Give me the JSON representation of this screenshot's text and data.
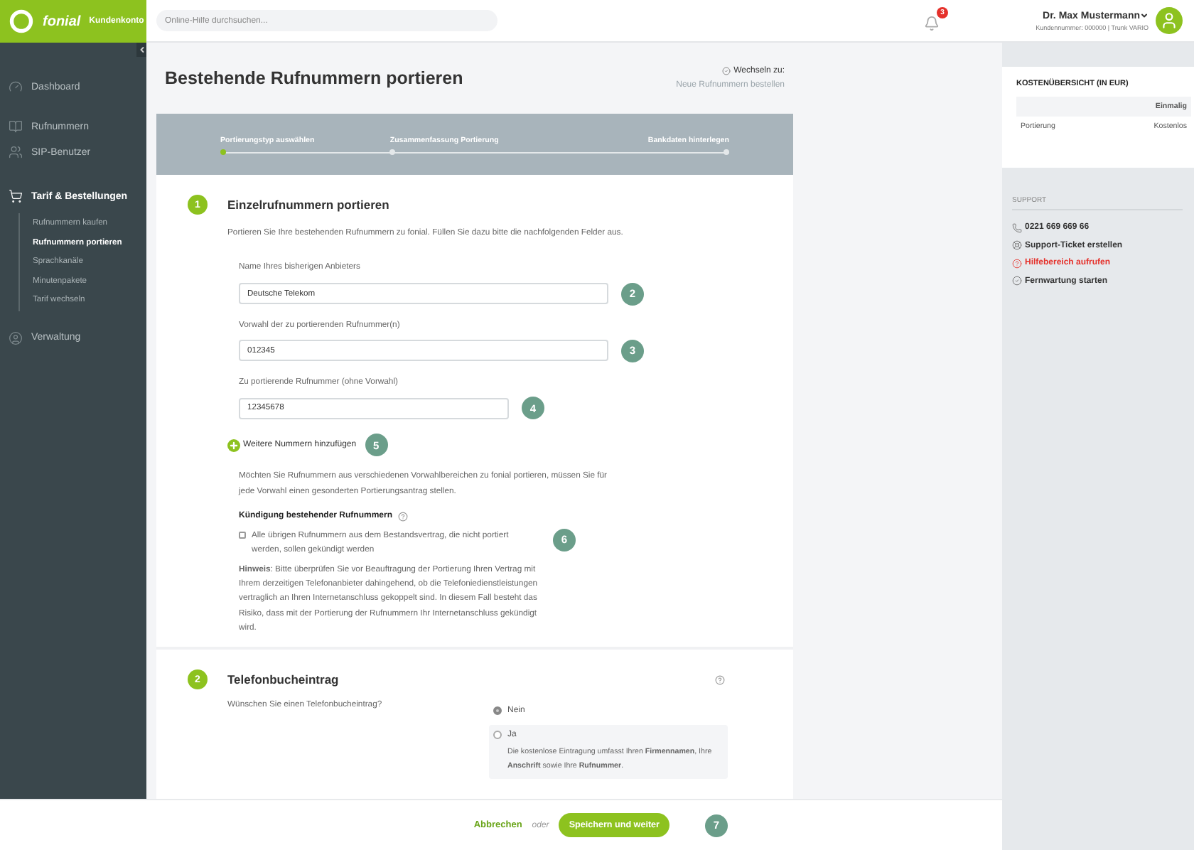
{
  "header": {
    "brand": "fonial",
    "brand_sub": "Kundenkonto",
    "search": {
      "placeholder": "Online-Hilfe durchsuchen..."
    },
    "notifications": "3",
    "user": {
      "name": "Dr. Max Mustermann",
      "meta": "Kundennummer: 000000 | Trunk VARIO"
    }
  },
  "sidebar": {
    "items": [
      {
        "label": "Dashboard",
        "selected": false
      },
      {
        "label": "Rufnummern",
        "selected": false
      },
      {
        "label": "SIP-Benutzer",
        "selected": false
      },
      {
        "label": "Tarif & Bestellungen",
        "selected": true,
        "expanded": true,
        "children": [
          {
            "label": "Rufnummern kaufen",
            "selected": false
          },
          {
            "label": "Rufnummern portieren",
            "selected": true
          },
          {
            "label": "Sprachkanäle",
            "selected": false
          },
          {
            "label": "Minutenpakete",
            "selected": false
          },
          {
            "label": "Tarif wechseln",
            "selected": false
          }
        ]
      },
      {
        "label": "Verwaltung",
        "selected": false
      }
    ]
  },
  "page": {
    "title": "Bestehende Rufnummern portieren",
    "switch_label": "Wechseln zu:",
    "switch_link": "Neue Rufnummern bestellen"
  },
  "steps": [
    {
      "label": "Portierungstyp auswählen",
      "selected": true
    },
    {
      "label": "Zusammenfassung Portierung",
      "selected": false
    },
    {
      "label": "Bankdaten hinterlegen",
      "selected": false
    }
  ],
  "section_1": {
    "number": "1",
    "title": "Einzelrufnummern portieren",
    "intro": "Portieren Sie Ihre bestehenden Rufnummern zu fonial. Füllen Sie dazu bitte die nachfolgenden Felder aus.",
    "fields": [
      {
        "label": "Name Ihres bisherigen Anbieters",
        "value": "Deutsche Telekom",
        "callout": "2"
      },
      {
        "label": "Vorwahl der zu portierenden Rufnummer(n)",
        "value": "012345",
        "callout": "3"
      },
      {
        "label": "Zu portierende Rufnummer (ohne Vorwahl)",
        "value": "12345678",
        "callout": "4"
      }
    ],
    "add_link": {
      "label": "Weitere Nummern hinzufügen",
      "callout": "5"
    },
    "note": "Möchten Sie Rufnummern aus verschiedenen Vorwahlbereichen zu fonial portieren, müssen Sie für jede Vorwahl einen gesonderten Portierungsantrag stellen.",
    "termination": {
      "title": "Kündigung bestehender Rufnummern",
      "checkbox": {
        "label": "Alle übrigen Rufnummern aus dem Bestandsvertrag, die nicht portiert werden, sollen gekündigt werden",
        "checked": false,
        "callout": "6"
      },
      "hint": "**Hinweis**: Bitte überprüfen Sie vor Beauftragung der Portierung Ihren Vertrag mit Ihrem derzeitigen Telefonanbieter dahingehend, ob die Telefoniedienstleistungen vertraglich an Ihren Internetanschluss gekoppelt sind. In diesem Fall besteht das Risiko, dass mit der Portierung der Rufnummern Ihr Internetanschluss gekündigt wird."
    }
  },
  "section_2": {
    "number": "2",
    "title": "Telefonbucheintrag",
    "question": "Wünschen Sie einen Telefonbucheintrag?",
    "options": [
      {
        "label": "Nein",
        "selected": true
      },
      {
        "label": "Ja",
        "selected": false,
        "description": "Die kostenlose Eintragung umfasst Ihren **Firmennamen**, Ihre **Anschrift** sowie Ihre **Rufnummer**."
      }
    ]
  },
  "footer": {
    "cancel": "Abbrechen",
    "or": "oder",
    "submit": "Speichern und weiter",
    "callout": "7"
  },
  "costs": {
    "title": "KOSTENÜBERSICHT (IN EUR)",
    "columns": [
      "Einmalig"
    ],
    "rows": [
      {
        "label": "Portierung",
        "value": "Kostenlos"
      }
    ]
  },
  "support": {
    "title": "SUPPORT",
    "items": [
      {
        "label": "0221 669 669 66",
        "highlighted": false
      },
      {
        "label": "Support-Ticket erstellen",
        "highlighted": false
      },
      {
        "label": "Hilfebereich aufrufen",
        "highlighted": true
      },
      {
        "label": "Fernwartung starten",
        "highlighted": false
      }
    ]
  }
}
